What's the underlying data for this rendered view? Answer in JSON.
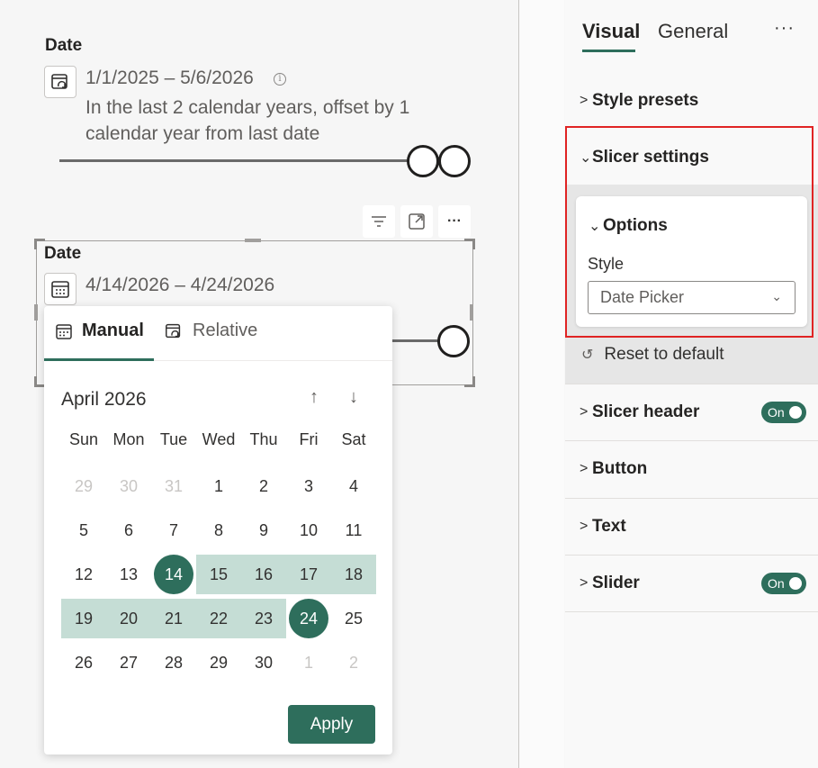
{
  "top_slicer": {
    "title": "Date",
    "mode_icon": "relative-date-icon",
    "range": "1/1/2025 – 5/6/2026",
    "info_icon": "info-icon",
    "description_line1": "In the last 2 calendar years, offset by 1",
    "description_line2": "calendar year from last date"
  },
  "visual_toolbar": {
    "filter_icon": "filter-icon",
    "focus_icon": "focus-mode-icon",
    "more_icon": "more-options-icon",
    "more_label": "···"
  },
  "bottom_slicer": {
    "title": "Date",
    "mode_icon": "calendar-icon",
    "range": "4/14/2026 – 4/24/2026"
  },
  "date_popup": {
    "tabs": [
      {
        "label": "Manual",
        "icon": "calendar-icon",
        "active": true
      },
      {
        "label": "Relative",
        "icon": "relative-date-icon",
        "active": false
      }
    ],
    "month": "April 2026",
    "nav_up": "↑",
    "nav_down": "↓",
    "weekdays": [
      "Sun",
      "Mon",
      "Tue",
      "Wed",
      "Thu",
      "Fri",
      "Sat"
    ],
    "weeks": [
      [
        {
          "d": "29",
          "m": true
        },
        {
          "d": "30",
          "m": true
        },
        {
          "d": "31",
          "m": true
        },
        {
          "d": "1"
        },
        {
          "d": "2"
        },
        {
          "d": "3"
        },
        {
          "d": "4"
        }
      ],
      [
        {
          "d": "5"
        },
        {
          "d": "6"
        },
        {
          "d": "7"
        },
        {
          "d": "8"
        },
        {
          "d": "9"
        },
        {
          "d": "10"
        },
        {
          "d": "11"
        }
      ],
      [
        {
          "d": "12"
        },
        {
          "d": "13"
        },
        {
          "d": "14",
          "s": true
        },
        {
          "d": "15",
          "r": true
        },
        {
          "d": "16",
          "r": true
        },
        {
          "d": "17",
          "r": true
        },
        {
          "d": "18",
          "r": true
        }
      ],
      [
        {
          "d": "19",
          "r": true
        },
        {
          "d": "20",
          "r": true
        },
        {
          "d": "21",
          "r": true
        },
        {
          "d": "22",
          "r": true
        },
        {
          "d": "23",
          "r": true
        },
        {
          "d": "24",
          "s": true
        },
        {
          "d": "25"
        }
      ],
      [
        {
          "d": "26"
        },
        {
          "d": "27"
        },
        {
          "d": "28"
        },
        {
          "d": "29"
        },
        {
          "d": "30"
        },
        {
          "d": "1",
          "m": true
        },
        {
          "d": "2",
          "m": true
        }
      ]
    ],
    "apply_label": "Apply"
  },
  "format_pane": {
    "tabs": [
      "Visual",
      "General"
    ],
    "more_label": "···",
    "style_presets": "Style presets",
    "slicer_settings": "Slicer settings",
    "options": "Options",
    "style_label": "Style",
    "style_value": "Date Picker",
    "reset_label": "Reset to default",
    "slicer_header": "Slicer header",
    "slicer_header_toggle": "On",
    "button": "Button",
    "text": "Text",
    "slider": "Slider",
    "slider_toggle": "On"
  },
  "colors": {
    "accent": "#2e6e5c",
    "range_fill": "#c5ddd5",
    "highlight_border": "#e02424"
  }
}
